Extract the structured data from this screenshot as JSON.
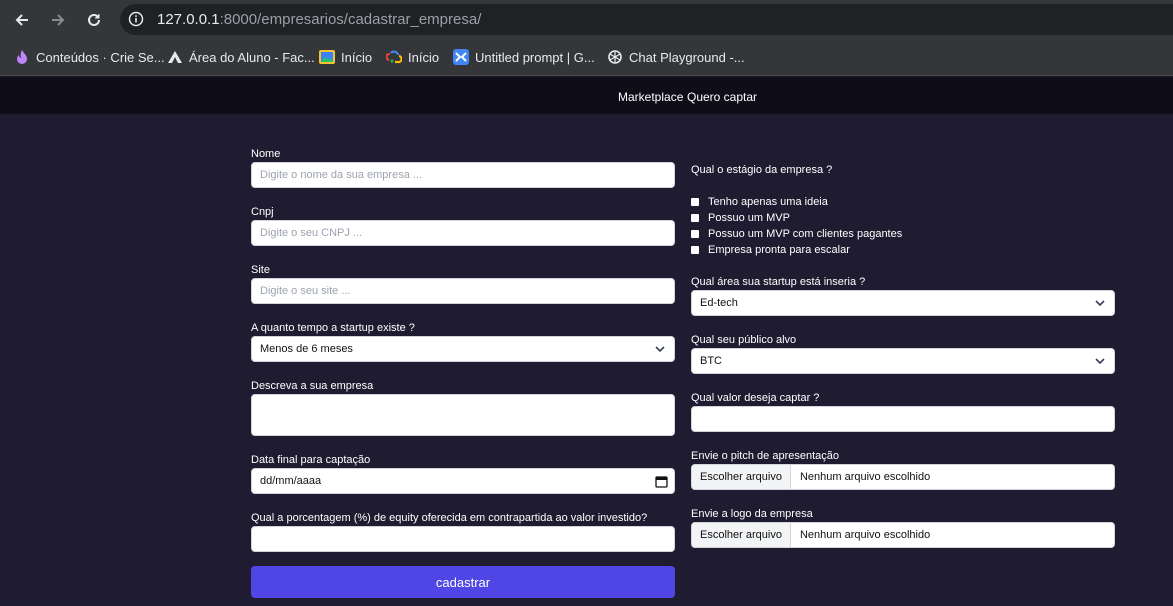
{
  "browser": {
    "url_host": "127.0.0.1",
    "url_rest": ":8000/empresarios/cadastrar_empresa/",
    "bookmarks": [
      {
        "label": "Conteúdos · Crie Se...",
        "icon": "flame-icon"
      },
      {
        "label": "Área do Aluno - Fac...",
        "icon": "mountain-logo-icon"
      },
      {
        "label": "Início",
        "icon": "picture-icon"
      },
      {
        "label": "Início",
        "icon": "google-cloud-icon"
      },
      {
        "label": "Untitled prompt | G...",
        "icon": "ai-studio-icon"
      },
      {
        "label": "Chat Playground -...",
        "icon": "openai-icon"
      }
    ]
  },
  "header": {
    "links": [
      "Marketplace",
      "Quero captar"
    ]
  },
  "form": {
    "nome": {
      "label": "Nome",
      "placeholder": "Digite o nome da sua empresa ..."
    },
    "cnpj": {
      "label": "Cnpj",
      "placeholder": "Digite o seu CNPJ ..."
    },
    "site": {
      "label": "Site",
      "placeholder": "Digite o seu site ..."
    },
    "tempo": {
      "label": "A quanto tempo a startup existe ?",
      "value": "Menos de 6 meses"
    },
    "descricao": {
      "label": "Descreva a sua empresa"
    },
    "data_final": {
      "label": "Data final para captação",
      "value": "dd/mm/aaaa"
    },
    "equity": {
      "label": "Qual a porcentagem (%) de equity oferecida em contrapartida ao valor investido?"
    },
    "estagio": {
      "label": "Qual o estágio da empresa ?",
      "options": [
        "Tenho apenas uma ideia",
        "Possuo um MVP",
        "Possuo um MVP com clientes pagantes",
        "Empresa pronta para escalar"
      ]
    },
    "area": {
      "label": "Qual área sua startup está inseria ?",
      "value": "Ed-tech"
    },
    "publico": {
      "label": "Qual seu público alvo",
      "value": "BTC"
    },
    "valor": {
      "label": "Qual valor deseja captar ?"
    },
    "pitch": {
      "label": "Envie o pitch de apresentação",
      "button": "Escolher arquivo",
      "status": "Nenhum arquivo escolhido"
    },
    "logo": {
      "label": "Envie a logo da empresa",
      "button": "Escolher arquivo",
      "status": "Nenhum arquivo escolhido"
    },
    "submit": "cadastrar"
  }
}
